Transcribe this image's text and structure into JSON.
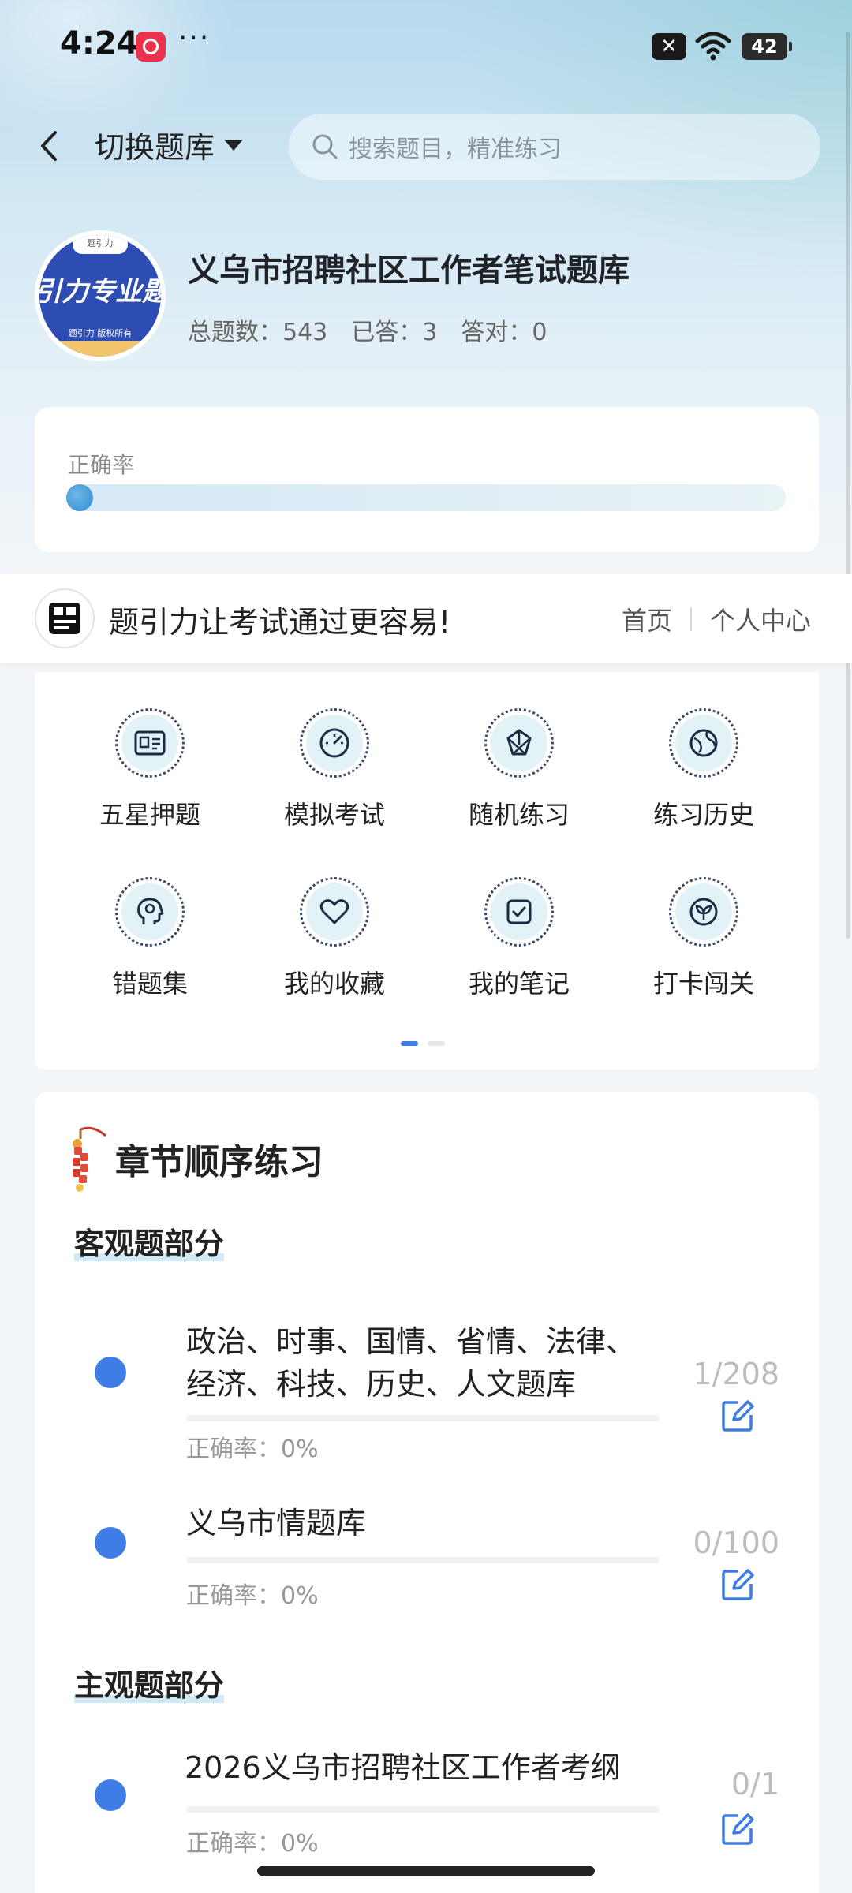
{
  "status_bar": {
    "time": "4:24",
    "more": "···",
    "close_badge": "✕",
    "battery": "42"
  },
  "header": {
    "switch_label": "切换题库",
    "search_placeholder": "搜索题目，精准练习"
  },
  "bank": {
    "logo_top": "题引力",
    "logo_main": "引力专业题",
    "logo_sub": "题引力 版权所有",
    "title": "义乌市招聘社区工作者笔试题库",
    "stats": [
      {
        "label": "总题数：",
        "value": "543"
      },
      {
        "label": "已答：",
        "value": "3"
      },
      {
        "label": "答对：",
        "value": "0"
      }
    ]
  },
  "accuracy": {
    "label": "正确率",
    "value": 0
  },
  "promo": {
    "logo_text": "题引力",
    "slogan": "题引力让考试通过更容易!",
    "home": "首页",
    "personal": "个人中心"
  },
  "tools": [
    {
      "label": "五星押题",
      "icon": "id-card-icon"
    },
    {
      "label": "模拟考试",
      "icon": "gauge-icon"
    },
    {
      "label": "随机练习",
      "icon": "shuffle-icon"
    },
    {
      "label": "练习历史",
      "icon": "globe-icon"
    },
    {
      "label": "错题集",
      "icon": "head-icon"
    },
    {
      "label": "我的收藏",
      "icon": "heart-icon"
    },
    {
      "label": "我的笔记",
      "icon": "note-check-icon"
    },
    {
      "label": "打卡闯关",
      "icon": "sprout-icon"
    }
  ],
  "chapters": {
    "title": "章节顺序练习",
    "sections": [
      {
        "title": "客观题部分",
        "items": [
          {
            "name": "政治、时事、国情、省情、法律、经济、科技、历史、人文题库",
            "accuracy": "正确率：0%",
            "count": "1/208"
          },
          {
            "name": "义乌市情题库",
            "accuracy": "正确率：0%",
            "count": "0/100"
          }
        ]
      },
      {
        "title": "主观题部分",
        "items": [
          {
            "name": "2026义乌市招聘社区工作者考纲",
            "accuracy": "正确率：0%",
            "count": "0/1"
          }
        ]
      }
    ]
  },
  "colors": {
    "accent": "#3f7de6",
    "icon_bg": "#e3f2f7",
    "logo_blue": "#2e4db4"
  }
}
